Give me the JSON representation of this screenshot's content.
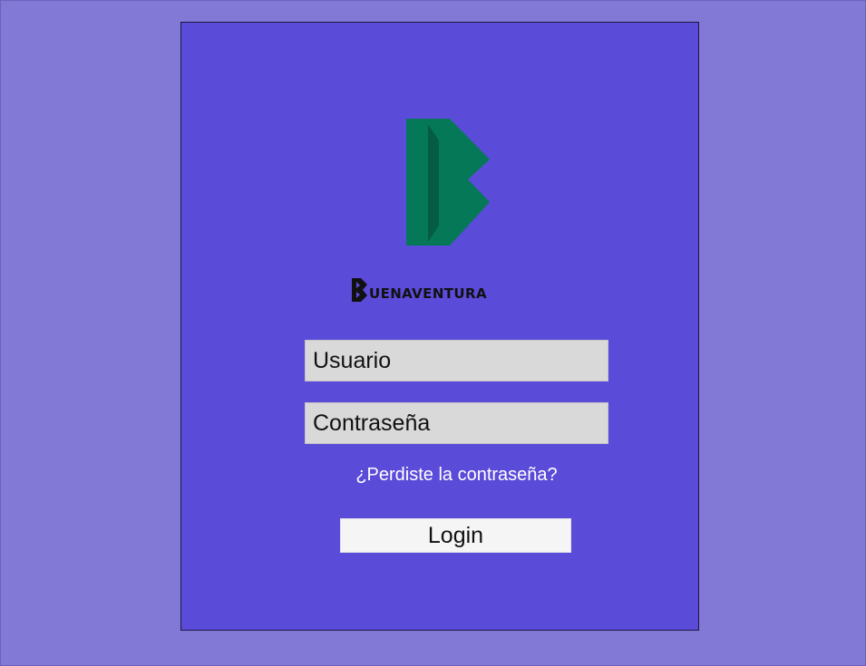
{
  "brand": {
    "name_rest": "UENAVENTURA",
    "mark_color": "#047857",
    "mark_dark_color": "#045c43"
  },
  "login_form": {
    "username_placeholder": "Usuario",
    "password_placeholder": "Contraseña",
    "forgot_password_label": "¿Perdiste la contraseña?",
    "login_button_label": "Login"
  },
  "colors": {
    "page_background": "#8278d6",
    "card_background": "#5b4bd9",
    "input_background": "#d9d9d9",
    "button_background": "#f5f5f5",
    "link_color": "#ffffff"
  }
}
